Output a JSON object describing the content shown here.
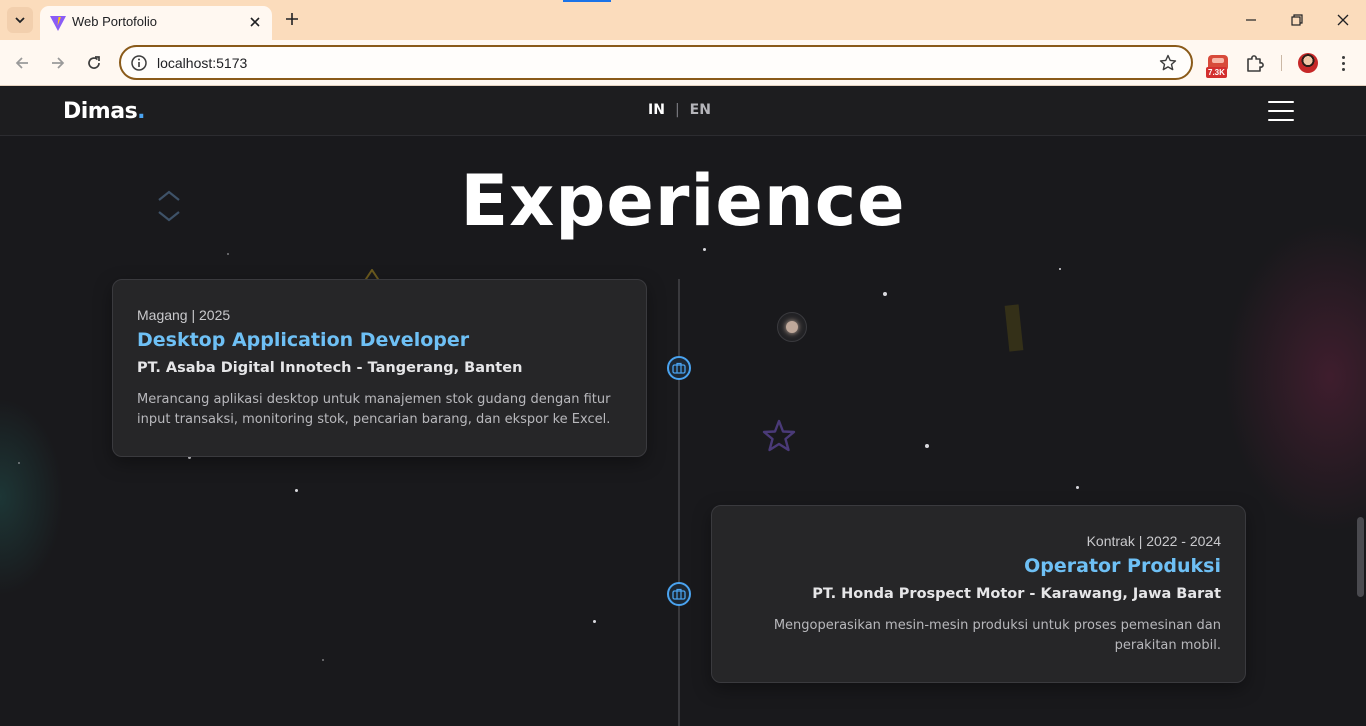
{
  "browser": {
    "tab_title": "Web Portofolio",
    "url": "localhost:5173",
    "extension_badge": "7.3K"
  },
  "site": {
    "logo_text": "Dimas",
    "logo_dot": ".",
    "lang_in": "IN",
    "lang_separator": "|",
    "lang_en": "EN"
  },
  "section": {
    "title": "Experience"
  },
  "experiences": [
    {
      "meta": "Magang | 2025",
      "role": "Desktop Application Developer",
      "company": "PT. Asaba Digital Innotech - Tangerang, Banten",
      "description": "Merancang aplikasi desktop untuk manajemen stok gudang dengan fitur input transaksi, monitoring stok, pencarian barang, dan ekspor ke Excel."
    },
    {
      "meta": "Kontrak | 2022 - 2024",
      "role": "Operator Produksi",
      "company": "PT. Honda Prospect Motor - Karawang, Jawa Barat",
      "description": "Mengoperasikan mesin-mesin produksi untuk proses pemesinan dan perakitan mobil."
    }
  ],
  "colors": {
    "accent": "#4aa3f0",
    "role_title": "#6ec0f5",
    "background": "#19191c",
    "card": "#262628"
  },
  "icons": {
    "timeline_node": "briefcase-icon",
    "menu": "hamburger-icon"
  }
}
